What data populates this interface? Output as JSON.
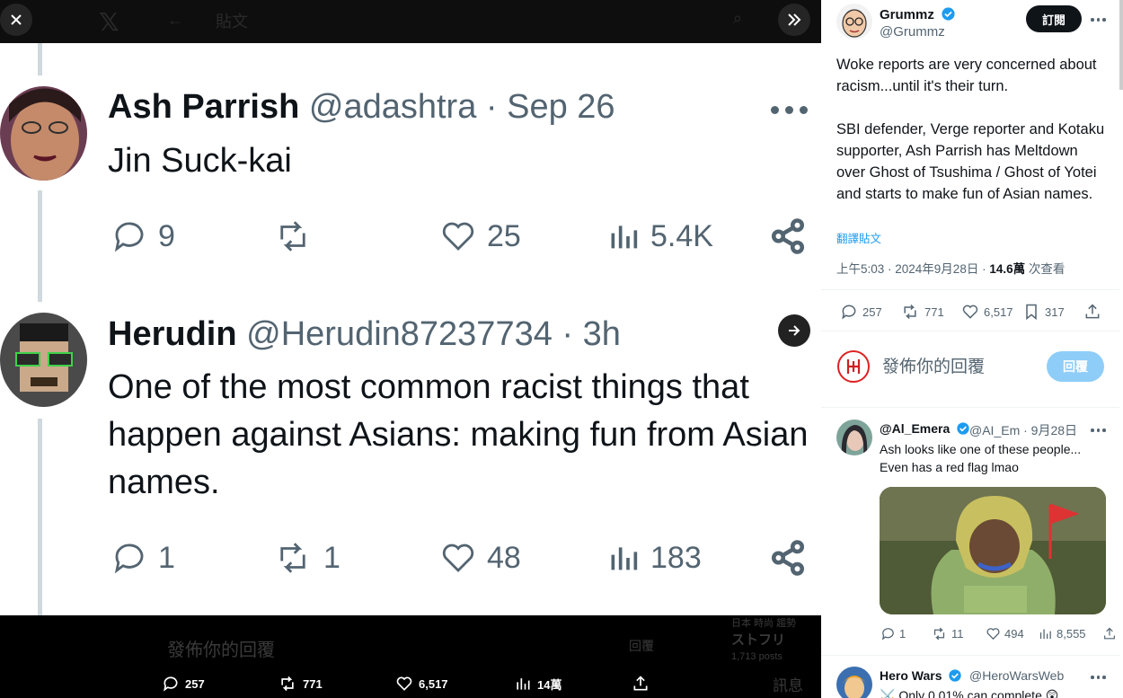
{
  "viewer": {
    "topbar_title": "貼文",
    "bottom_ghost": {
      "reply_placeholder": "發佈你的回覆",
      "reply_button": "回覆",
      "side_line1": "日本 時尚 趨勢",
      "side_line2": "ストフリ",
      "side_line3": "1,713 posts",
      "side_line4": "訊息"
    },
    "bottom_stats": {
      "replies": "257",
      "reposts": "771",
      "likes": "6,517",
      "views": "14萬"
    }
  },
  "screenshot": {
    "tweet1": {
      "name": "Ash Parrish",
      "handle": "@adashtra",
      "time": "Sep 26",
      "text": "Jin Suck-kai",
      "replies": "9",
      "reposts": "",
      "likes": "25",
      "views": "5.4K"
    },
    "tweet2": {
      "name": "Herudin",
      "handle": "@Herudin87237734",
      "time": "3h",
      "text": "One of the most common racist things that happen against Asians: making fun from Asian names.",
      "replies": "1",
      "reposts": "1",
      "likes": "48",
      "views": "183"
    }
  },
  "panel": {
    "author_name": "Grummz",
    "author_handle": "@Grummz",
    "subscribe_label": "訂閱",
    "post_text_p1": "Woke reports are very concerned about racism...until it's their turn.",
    "post_text_p2": "SBI defender, Verge reporter and Kotaku supporter, Ash Parrish has Meltdown over Ghost of Tsushima / Ghost of Yotei and starts to make fun of Asian names.",
    "translate_label": "翻譯貼文",
    "meta_time": "上午5:03 · 2024年9月28日 · ",
    "meta_views_count": "14.6萬",
    "meta_views_label": " 次查看",
    "stats": {
      "replies": "257",
      "reposts": "771",
      "likes": "6,517",
      "bookmarks": "317"
    },
    "reply_placeholder": "發佈你的回覆",
    "reply_button": "回覆",
    "replies": [
      {
        "name": "@Al_Emera",
        "handle": "@AI_Em · 9月28日",
        "text": "Ash looks like one of these people... Even has a red flag lmao",
        "stats": {
          "replies": "1",
          "reposts": "11",
          "likes": "494",
          "views": "8,555"
        }
      },
      {
        "name": "Hero Wars",
        "handle": "@HeroWarsWeb",
        "text": "⚔️ Only 0.01% can complete 😲"
      }
    ]
  },
  "colors": {
    "accent": "#1d9bf0",
    "reply_button_disabled": "#8ecdf8",
    "secondary_text": "#536471"
  }
}
